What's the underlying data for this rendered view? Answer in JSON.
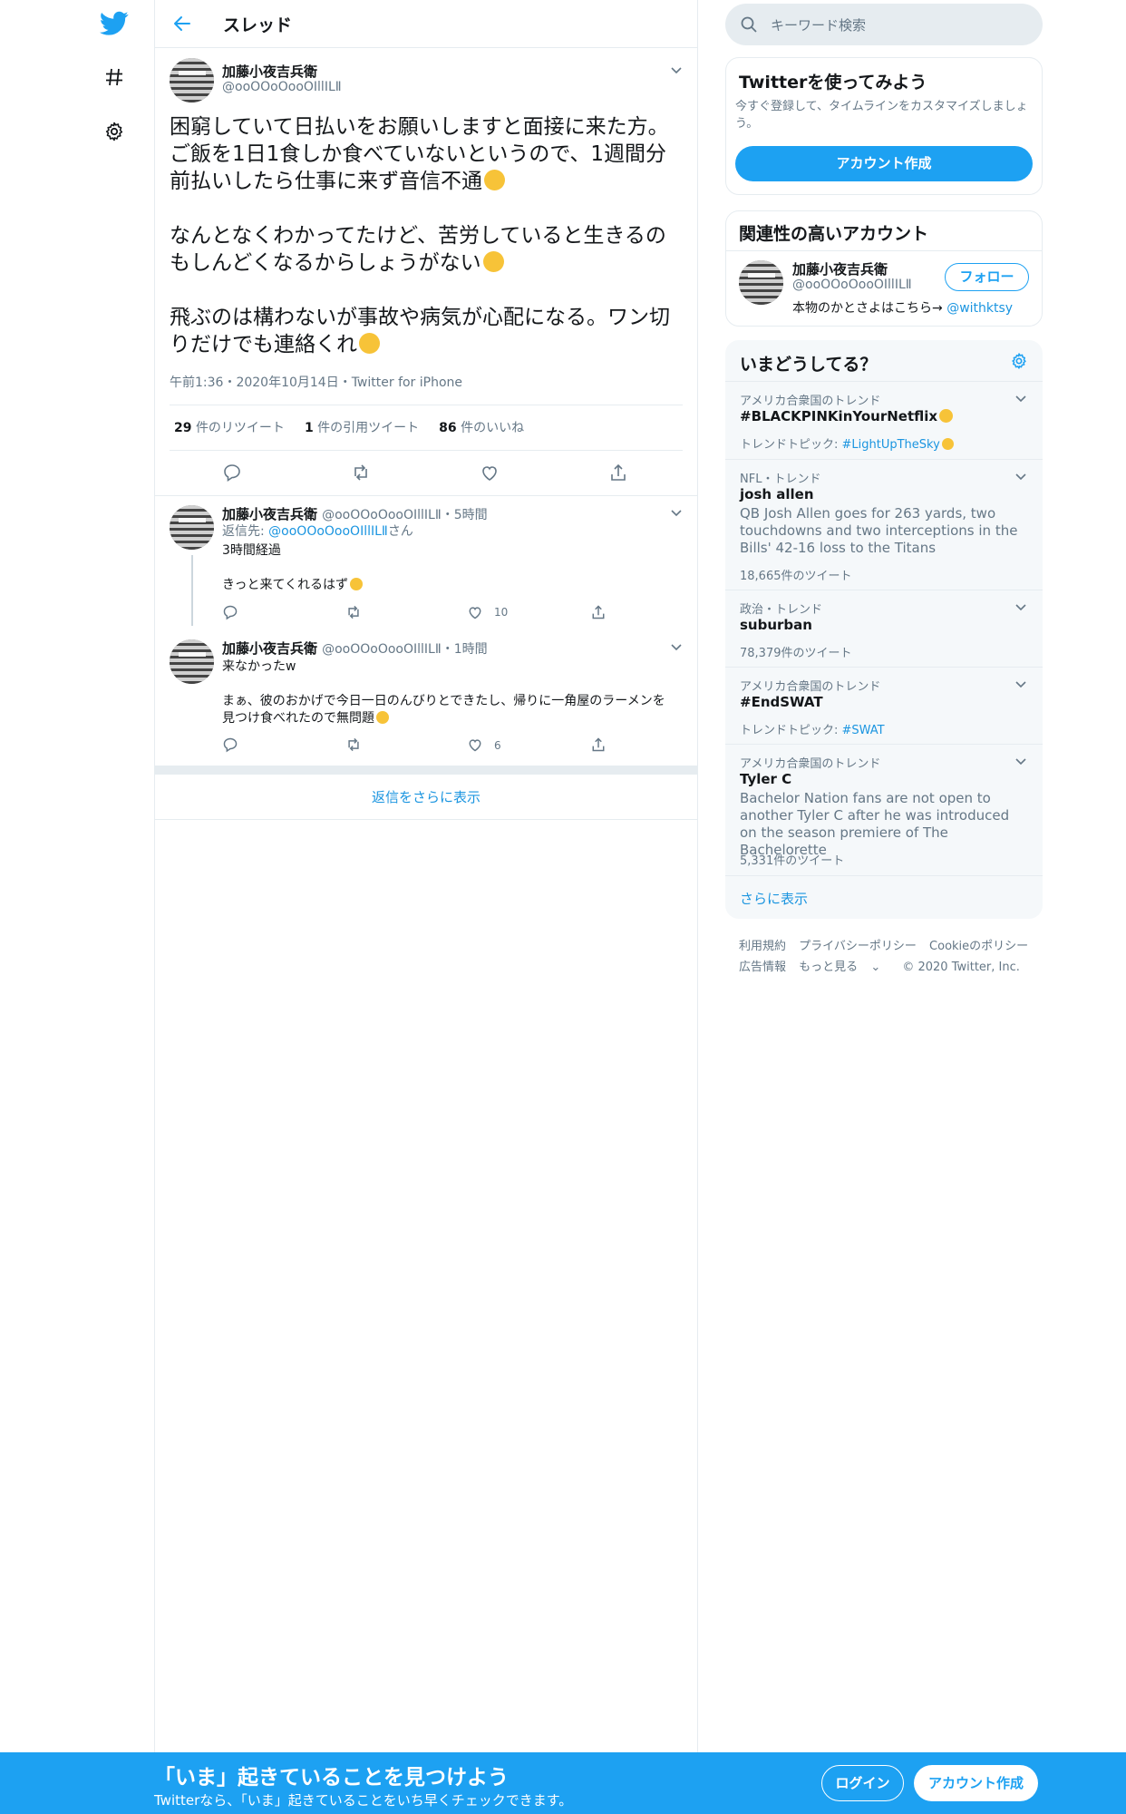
{
  "header": {
    "title": "スレッド"
  },
  "tweet": {
    "name": "加藤小夜吉兵衛",
    "handle": "@ooOOoOooOIllILⅡ",
    "paragraphs": [
      "困窮していて日払いをお願いしますと面接に来た方。ご飯を1日1食しか食べていないというので、1週間分前払いしたら仕事に来ず音信不通",
      "なんとなくわかってたけど、苦労していると生きるのもしんどくなるからしょうがない",
      "飛ぶのは構わないが事故や病気が心配になる。ワン切りだけでも連絡くれ"
    ],
    "meta": "午前1:36・2020年10月14日・Twitter for iPhone",
    "stats": {
      "retweets_n": "29",
      "retweets_l": "件のリツイート",
      "quotes_n": "1",
      "quotes_l": "件の引用ツイート",
      "likes_n": "86",
      "likes_l": "件のいいね"
    }
  },
  "replies": [
    {
      "name": "加藤小夜吉兵衛",
      "handle_time": "@ooOOoOooOIllILⅡ・5時間",
      "reply_to_label": "返信先: ",
      "reply_to_handle": "@ooOOoOooOIllILⅡ",
      "reply_to_suffix": "さん",
      "line1": "3時間経過",
      "line2": "きっと来てくれるはず",
      "likes": "10"
    },
    {
      "name": "加藤小夜吉兵衛",
      "handle_time": "@ooOOoOooOIllILⅡ・1時間",
      "line1": "来なかったw",
      "line2": "まぁ、彼のおかげで今日一日のんびりとできたし、帰りに一角屋のラーメンを見つけ食べれたので無問題",
      "likes": "6"
    }
  ],
  "show_more_replies": "返信をさらに表示",
  "search": {
    "placeholder": "キーワード検索"
  },
  "signup_card": {
    "title": "Twitterを使ってみよう",
    "desc": "今すぐ登録して、タイムラインをカスタマイズしましょう。",
    "button": "アカウント作成"
  },
  "related": {
    "title": "関連性の高いアカウント",
    "name": "加藤小夜吉兵衛",
    "handle": "@ooOOoOooOIllILⅡ",
    "bio": "本物のかとさよはこちら→ ",
    "bio_link": "@withktsy",
    "follow": "フォロー"
  },
  "trends": {
    "title": "いまどうしてる？",
    "items": [
      {
        "context": "アメリカ合衆国のトレンド",
        "name": "#BLACKPINKinYourNetflix",
        "topic_label": "トレンドトピック: ",
        "topic": "#LightUpTheSky"
      },
      {
        "context": "NFL・トレンド",
        "name": "josh allen",
        "desc": "QB Josh Allen goes for 263 yards, two touchdowns and two interceptions in the Bills' 42-16 loss to the Titans",
        "count": "18,665件のツイート"
      },
      {
        "context": "政治・トレンド",
        "name": "suburban",
        "count": "78,379件のツイート"
      },
      {
        "context": "アメリカ合衆国のトレンド",
        "name": "#EndSWAT",
        "topic_label": "トレンドトピック: ",
        "topic": "#SWAT"
      },
      {
        "context": "アメリカ合衆国のトレンド",
        "name": "Tyler C",
        "desc": "Bachelor Nation fans are not open to another Tyler C after he was introduced on the season premiere of The Bachelorette",
        "count": "5,331件のツイート"
      }
    ],
    "show_more": "さらに表示"
  },
  "footer": {
    "terms": "利用規約",
    "privacy": "プライバシーポリシー",
    "cookie": "Cookieのポリシー",
    "ads": "広告情報",
    "more": "もっと見る",
    "copyright": "© 2020 Twitter, Inc."
  },
  "bottom": {
    "headline": "「いま」起きていることを見つけよう",
    "sub": "Twitterなら、「いま」起きていることをいち早くチェックできます。",
    "login": "ログイン",
    "signup": "アカウント作成"
  },
  "colors": {
    "accent": "#1da1f2",
    "link": "#1b95e0",
    "muted": "#657786",
    "border": "#e6ecf0"
  }
}
